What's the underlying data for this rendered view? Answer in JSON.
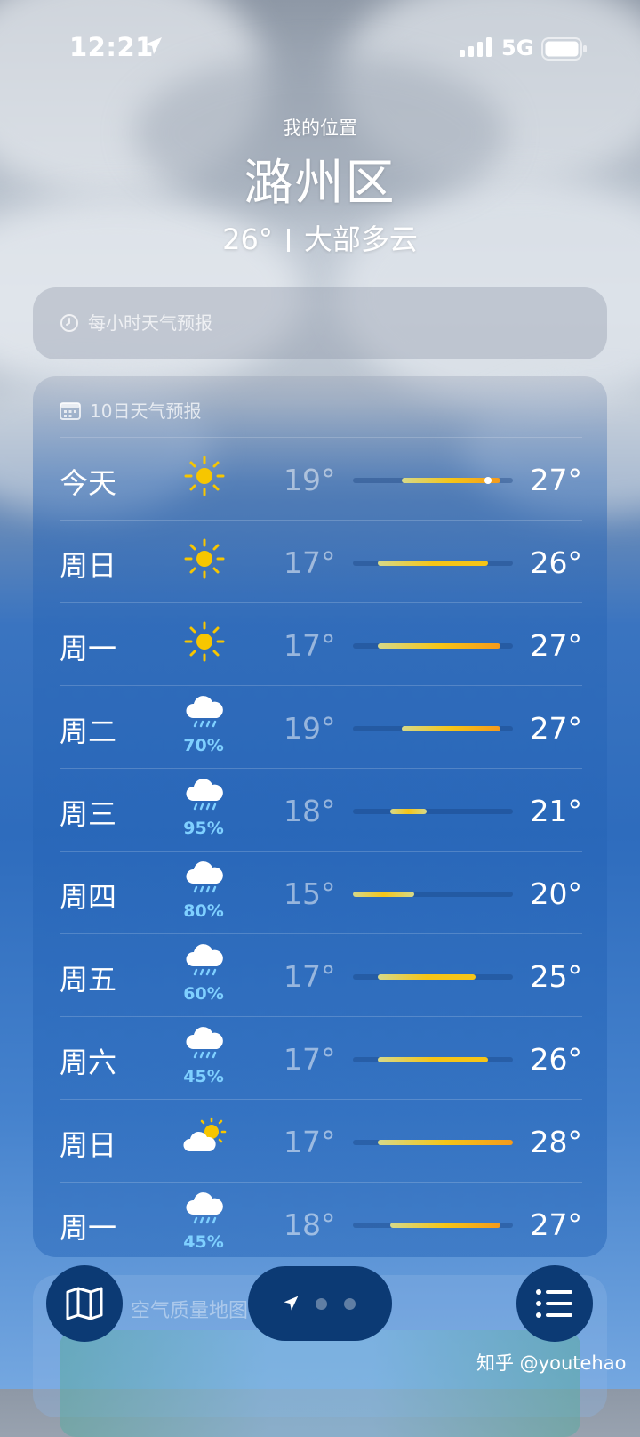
{
  "status_bar": {
    "time": "12:21",
    "network": "5G"
  },
  "header": {
    "my_location": "我的位置",
    "city": "潞州区",
    "temperature": "26°",
    "condition": "大部多云"
  },
  "hourly_panel": {
    "title": "每小时天气预报"
  },
  "forecast_panel": {
    "title": "10日天气预报",
    "rows": [
      {
        "day": "今天",
        "icon": "sun-icon",
        "precip": "",
        "low": "19°",
        "high": "27°"
      },
      {
        "day": "周日",
        "icon": "sun-icon",
        "precip": "",
        "low": "17°",
        "high": "26°"
      },
      {
        "day": "周一",
        "icon": "sun-icon",
        "precip": "",
        "low": "17°",
        "high": "27°"
      },
      {
        "day": "周二",
        "icon": "rain-cloud-icon",
        "precip": "70%",
        "low": "19°",
        "high": "27°"
      },
      {
        "day": "周三",
        "icon": "rain-cloud-icon",
        "precip": "95%",
        "low": "18°",
        "high": "21°"
      },
      {
        "day": "周四",
        "icon": "rain-cloud-icon",
        "precip": "80%",
        "low": "15°",
        "high": "20°"
      },
      {
        "day": "周五",
        "icon": "rain-cloud-icon",
        "precip": "60%",
        "low": "17°",
        "high": "25°"
      },
      {
        "day": "周六",
        "icon": "rain-cloud-icon",
        "precip": "45%",
        "low": "17°",
        "high": "26°"
      },
      {
        "day": "周日",
        "icon": "partly-sunny-icon",
        "precip": "",
        "low": "17°",
        "high": "28°"
      },
      {
        "day": "周一",
        "icon": "rain-cloud-icon",
        "precip": "45%",
        "low": "18°",
        "high": "27°"
      }
    ],
    "range": {
      "min": 15,
      "max": 28
    },
    "current_temp": 26,
    "colors": {
      "cool": "#d6d98a",
      "warm": "#f5c518",
      "hot": "#f59a1c"
    }
  },
  "aqi_panel": {
    "title": "空气质量地图"
  },
  "watermark": "知乎 @youtehao"
}
